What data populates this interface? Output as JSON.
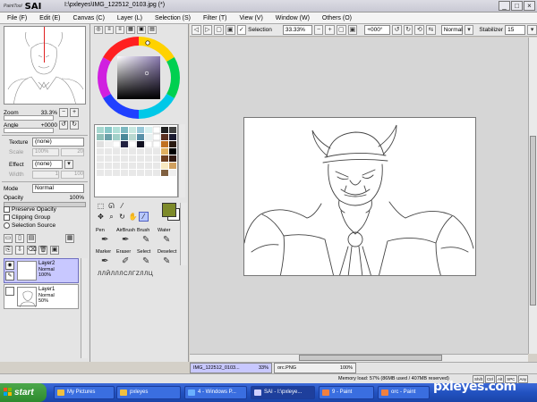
{
  "window": {
    "logo_small": "PaintTool",
    "logo_main": "SAI",
    "title": "I:\\pxleyes\\IMG_122512_0103.jpg (*)",
    "buttons": [
      "_",
      "□",
      "×"
    ]
  },
  "menu": {
    "items": [
      "File (F)",
      "Edit (E)",
      "Canvas (C)",
      "Layer (L)",
      "Selection (S)",
      "Filter (T)",
      "View (V)",
      "Window (W)",
      "Others (O)"
    ]
  },
  "navigator": {
    "zoom_label": "Zoom",
    "zoom_value": "33.3%",
    "angle_label": "Angle",
    "angle_value": "+0000"
  },
  "texture": {
    "texture_label": "Texture",
    "texture_value": "(none)",
    "scale_label": "Scale",
    "scale_value": "100%",
    "scale_num": "20",
    "effect_label": "Effect",
    "effect_value": "(none)",
    "width_label": "Width",
    "width_num": "1",
    "width_max": "100"
  },
  "layer_props": {
    "mode_label": "Mode",
    "mode_value": "Normal",
    "opacity_label": "Opacity",
    "opacity_value": "100%",
    "preserve_opacity": "Preserve Opacity",
    "clipping_group": "Clipping Group",
    "selection_source": "Selection Source"
  },
  "layers": [
    {
      "name": "Layer2",
      "mode": "Normal",
      "opacity": "100%"
    },
    {
      "name": "Layer1",
      "mode": "Normal",
      "opacity": "50%"
    }
  ],
  "brushes": [
    {
      "name": "Pen"
    },
    {
      "name": "AirBrush"
    },
    {
      "name": "Brush"
    },
    {
      "name": "Water"
    },
    {
      "name": "Marker"
    },
    {
      "name": "Eraser"
    },
    {
      "name": "Select"
    },
    {
      "name": "Deselect"
    }
  ],
  "brush_extra": "ЛЛЙЛЛЛСЛΓΖЛЛЦ",
  "toolbar": {
    "selection_label": "Selection",
    "zoom_value": "33.33%",
    "angle_value": "+000°",
    "mode_value": "Normal",
    "stabilizer_label": "Stabilizer",
    "stabilizer_value": "15"
  },
  "doc_tabs": [
    {
      "name": "IMG_122512_0103...",
      "zoom": "33%"
    },
    {
      "name": "orc.PNG",
      "zoom": "100%"
    }
  ],
  "status": {
    "memory": "Memory load: 57% (86MB used / 407MB reserved)",
    "keys": [
      "Shift",
      "Ctrl",
      "Alt",
      "SPC",
      "Any"
    ]
  },
  "taskbar": {
    "start": "start",
    "items": [
      "My Pictures",
      "pxleyes",
      "4 - Windows P...",
      "SAI - I:\\pxleye...",
      "",
      "9 - Paint",
      "orc - Paint"
    ],
    "watermark": "pxleyes.com"
  },
  "colors": {
    "foreground": "#7d8a2a",
    "background": "#ffffff",
    "selection": "#c8c8ff"
  }
}
